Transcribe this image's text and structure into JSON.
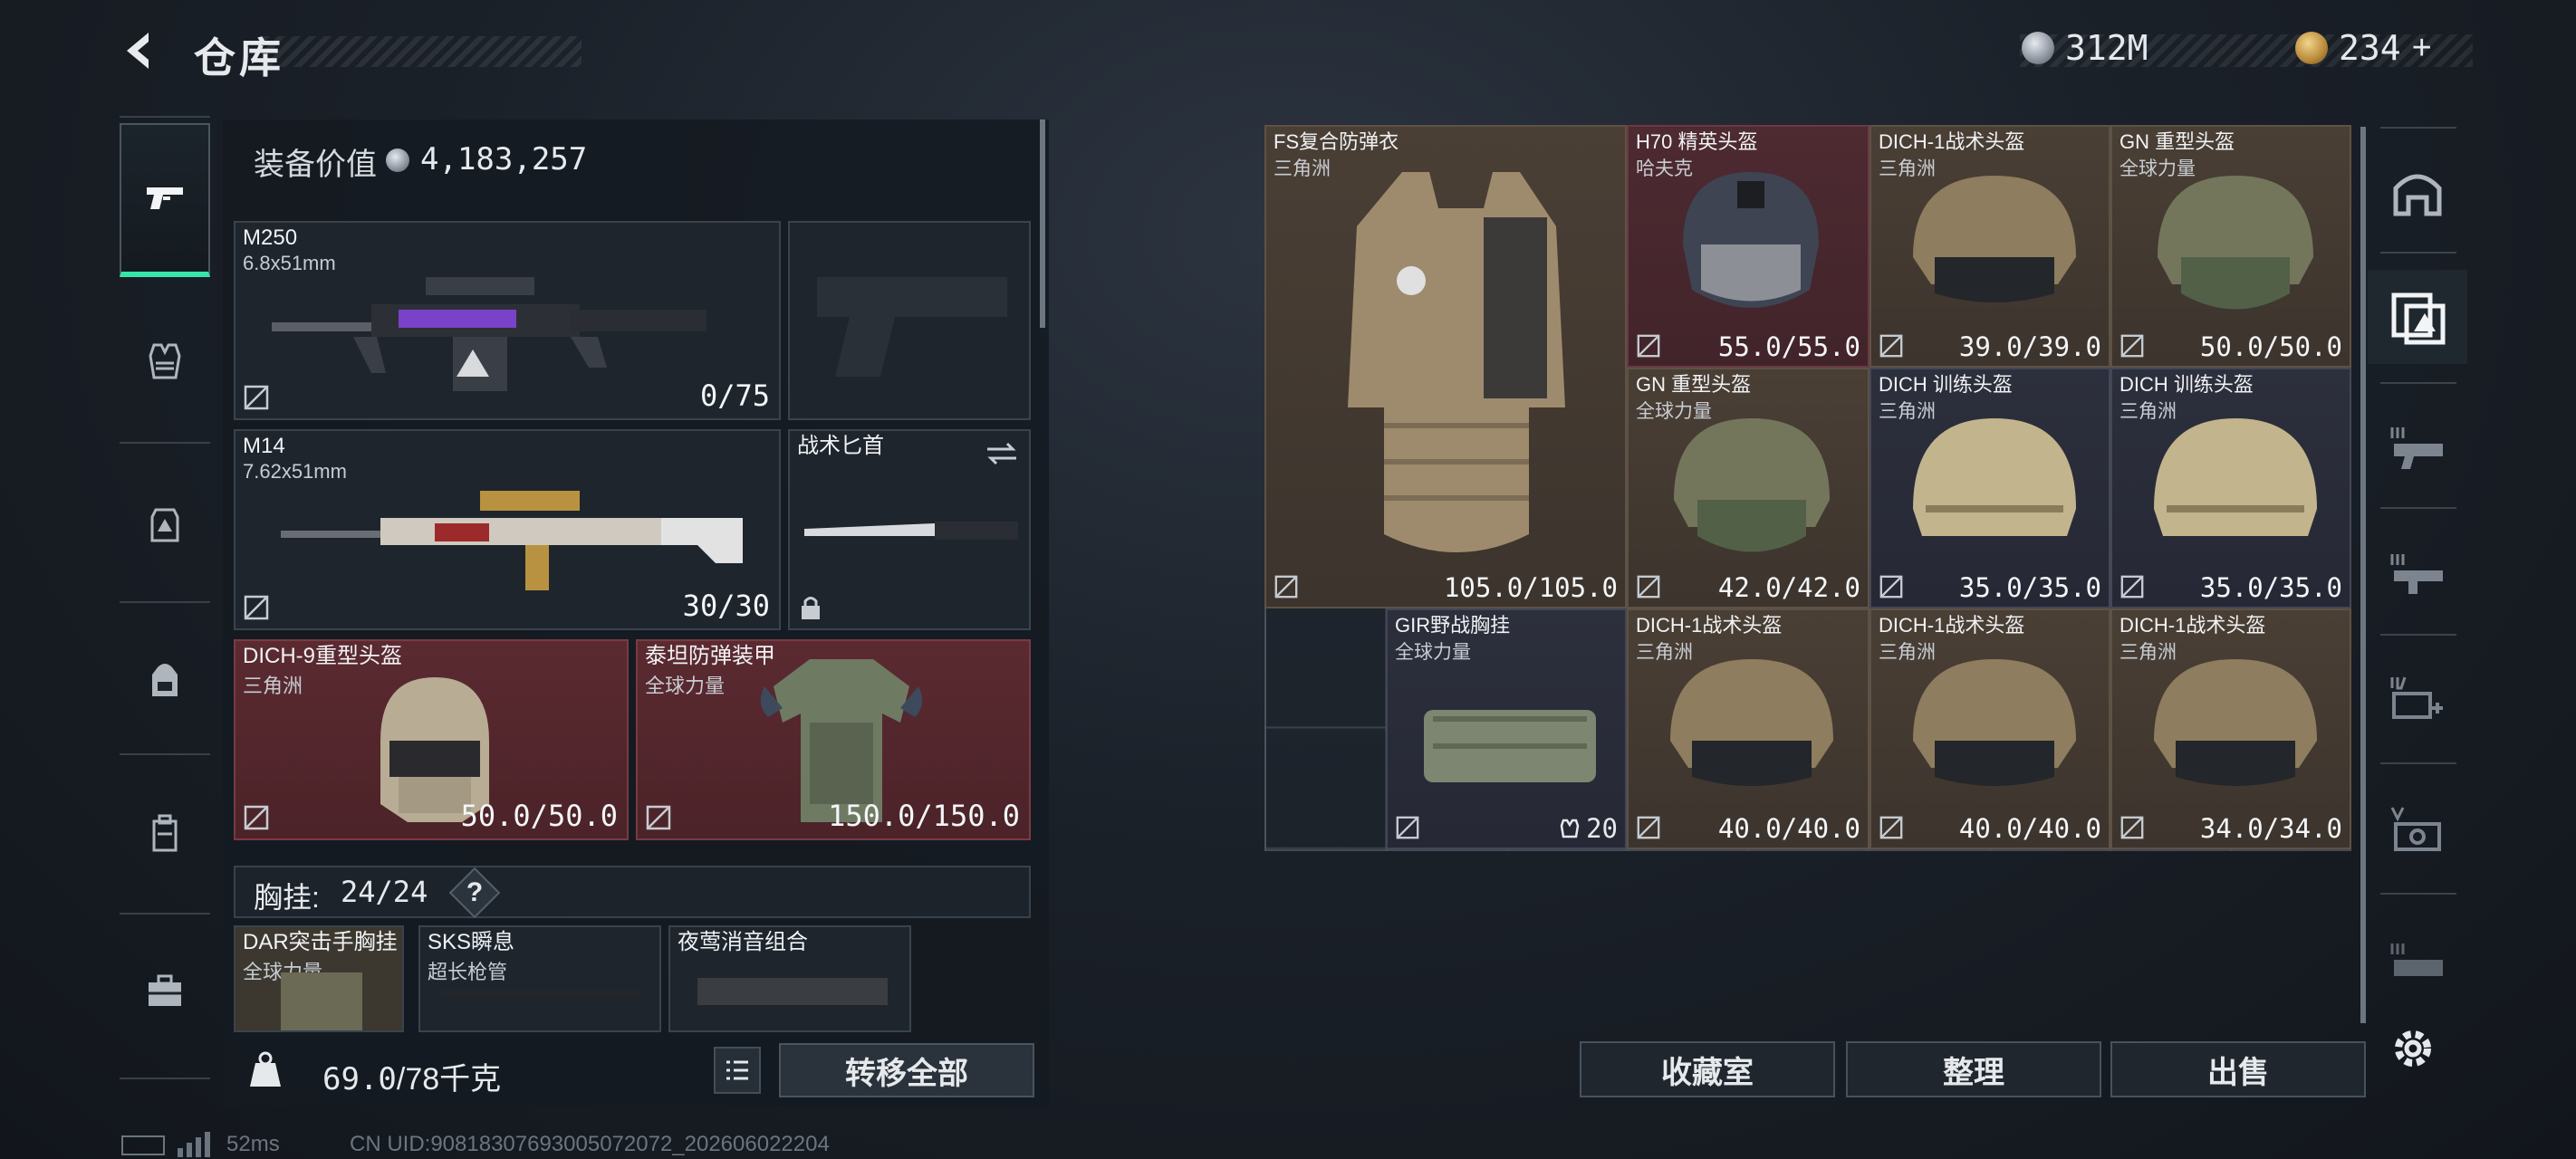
{
  "header": {
    "title": "仓库",
    "currency1": "312M",
    "currency2": "234",
    "currency2_suffix": "+"
  },
  "left_nav": {
    "items": [
      "pistol-icon",
      "vest-icon",
      "bag-icon",
      "backpack-icon",
      "case-icon",
      "toolbox-icon"
    ],
    "active": "pistol-icon"
  },
  "loadout": {
    "value_label": "装备价值",
    "value": "4,183,257",
    "primary": {
      "name": "M250",
      "caliber": "6.8x51mm",
      "ammo": "0/75"
    },
    "secondary": {
      "name": "M14",
      "caliber": "7.62x51mm",
      "ammo": "30/30"
    },
    "melee": {
      "name": "战术匕首"
    },
    "helmet": {
      "name": "DICH-9重型头盔",
      "sub": "三角洲",
      "durability": "50.0/50.0"
    },
    "armor": {
      "name": "泰坦防弹装甲",
      "sub": "全球力量",
      "durability": "150.0/150.0"
    },
    "chest_label": "胸挂:",
    "chest_value": "24/24",
    "chest_help": "?",
    "attachments": [
      {
        "name": "DAR突击手胸挂",
        "sub": "全球力量"
      },
      {
        "name": "SKS瞬息",
        "sub": "超长枪管"
      },
      {
        "name": "夜莺消音组合",
        "sub": ""
      }
    ],
    "weight": "69.0",
    "weight_max": "/78千克",
    "transfer_all": "转移全部"
  },
  "storage": {
    "items": [
      {
        "name": "FS复合防弹衣",
        "sub": "三角洲",
        "durability": "105.0/105.0"
      },
      {
        "name": "H70 精英头盔",
        "sub": "哈夫克",
        "durability": "55.0/55.0"
      },
      {
        "name": "DICH-1战术头盔",
        "sub": "三角洲",
        "durability": "39.0/39.0"
      },
      {
        "name": "GN 重型头盔",
        "sub": "全球力量",
        "durability": "50.0/50.0"
      },
      {
        "name": "GN 重型头盔",
        "sub": "全球力量",
        "durability": "42.0/42.0"
      },
      {
        "name": "DICH 训练头盔",
        "sub": "三角洲",
        "durability": "35.0/35.0"
      },
      {
        "name": "DICH 训练头盔",
        "sub": "三角洲",
        "durability": "35.0/35.0"
      },
      {
        "name": "GIR野战胸挂",
        "sub": "全球力量",
        "capacity": "20"
      },
      {
        "name": "DICH-1战术头盔",
        "sub": "三角洲",
        "durability": "40.0/40.0"
      },
      {
        "name": "DICH-1战术头盔",
        "sub": "三角洲",
        "durability": "40.0/40.0"
      },
      {
        "name": "DICH-1战术头盔",
        "sub": "三角洲",
        "durability": "34.0/34.0"
      }
    ],
    "buttons": {
      "collection": "收藏室",
      "organize": "整理",
      "sell": "出售"
    }
  },
  "right_nav": {
    "items": [
      "stash-icon",
      "filter-icon",
      "tier-III-weapon-icon",
      "tier-III-weapon-2-icon",
      "tier-IV-medkit-icon",
      "tier-V-case-icon",
      "tier-III-misc-icon"
    ],
    "active": "filter-icon"
  },
  "status_bar": {
    "ping": "52ms",
    "uid": "CN UID:90818307693005072072_202606022204"
  },
  "colors": {
    "accent": "#37e6a6",
    "red_slot": "#5b2a31",
    "brown_slot": "#4a3f35",
    "navy_slot": "#2c2f3c"
  }
}
